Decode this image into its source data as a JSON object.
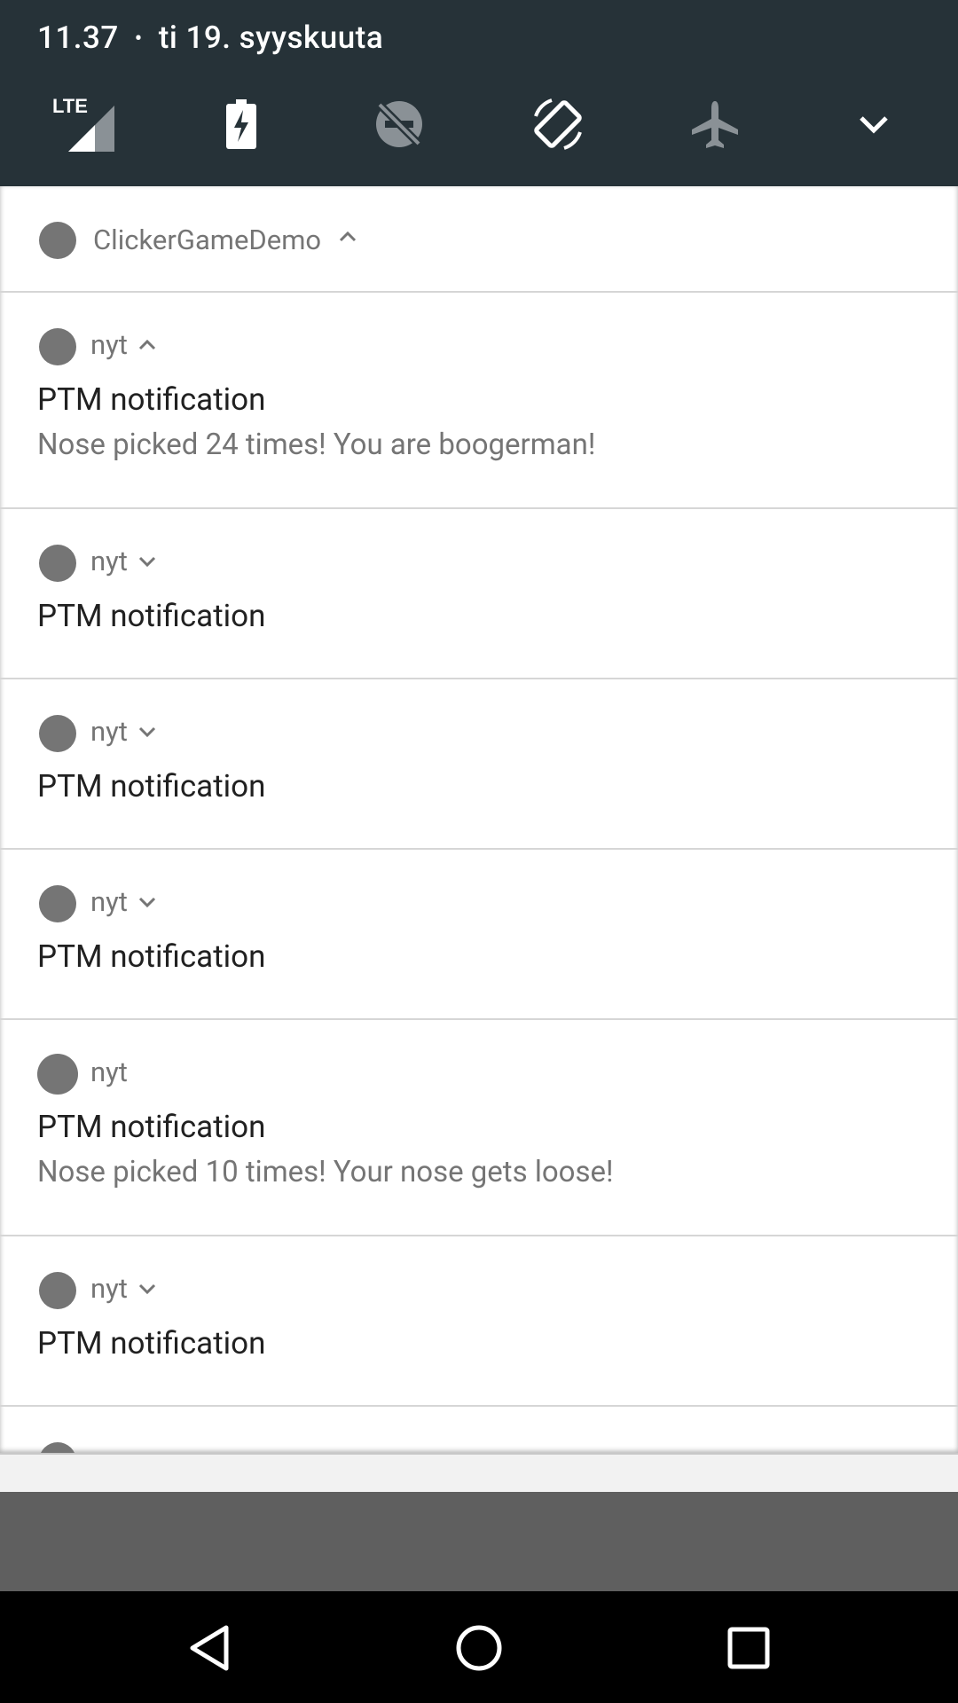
{
  "status_bar": {
    "time": "11.37",
    "separator": "•",
    "date": "ti 19. syyskuuta"
  },
  "quick_settings": [
    {
      "icon": "lte-signal-icon",
      "label": "LTE"
    },
    {
      "icon": "battery-saver-icon"
    },
    {
      "icon": "data-saver-off-icon"
    },
    {
      "icon": "auto-rotate-icon"
    },
    {
      "icon": "airplane-mode-icon"
    },
    {
      "icon": "expand-chevron-icon"
    }
  ],
  "group": {
    "app_name": "ClickerGameDemo"
  },
  "notifications": [
    {
      "time": "nyt",
      "title": "PTM notification",
      "text": "Nose picked 24 times! You are boogerman!",
      "chevron": "up"
    },
    {
      "time": "nyt",
      "title": "PTM notification",
      "chevron": "down"
    },
    {
      "time": "nyt",
      "title": "PTM notification",
      "chevron": "down"
    },
    {
      "time": "nyt",
      "title": "PTM notification",
      "chevron": "down"
    },
    {
      "time": "nyt",
      "title": "PTM notification",
      "text": "Nose picked 10 times! Your nose gets loose!",
      "chevron": "none"
    },
    {
      "time": "nyt",
      "title": "PTM notification",
      "chevron": "down"
    }
  ],
  "colors": {
    "header_bg": "#263238",
    "icon_gray": "#757575",
    "title_text": "#212121",
    "divider": "#d6d6d6"
  }
}
